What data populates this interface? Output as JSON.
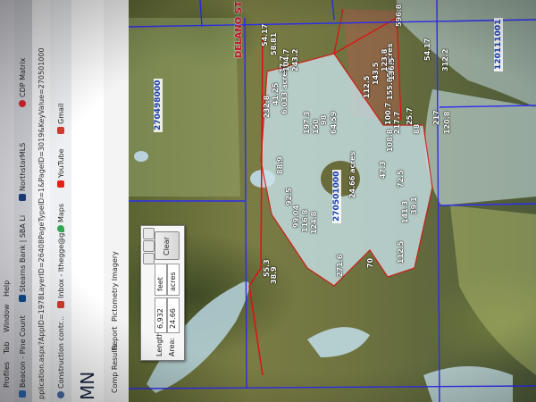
{
  "browser": {
    "menu": [
      "Profiles",
      "Tab",
      "Window",
      "Help"
    ],
    "tabs": [
      "Beacon - Pine Count",
      "Stearns Bank | SBA Li",
      "NorthstarMLS",
      "CDP Matrix"
    ],
    "url_fragment": "pplication.aspx?AppID=1978LayerID=26408PageTypeID=1&PageID=3019&KeyValue=270501000",
    "bookmarks": [
      "Construction contr...",
      "Inbox - lthegge@g...",
      "Maps",
      "YouTube",
      "Gmail"
    ]
  },
  "page": {
    "heading_partial": "MN"
  },
  "app_toolbar": {
    "items": [
      "Comp Results",
      "Report",
      "Pictometry Imagery"
    ]
  },
  "measure_tool": {
    "length_label": "Length:",
    "length_value": "6,932",
    "length_unit": "feet",
    "area_label": "Area:",
    "area_value": "24.66",
    "area_unit": "acres",
    "clear_label": "Clear"
  },
  "map": {
    "parcel_ids": [
      "270498000",
      "270501000",
      "120111001"
    ],
    "road_label": "DELANO ST",
    "area_annotations": [
      "24.66 acres",
      "6.033 acres",
      "155.858 acres"
    ],
    "segment_labels": [
      "54.17",
      "58.81",
      "232.8",
      "41.25",
      "37.7",
      "104.7",
      "243.2",
      "197.3",
      "150",
      "98",
      "64.59",
      "88.9",
      "92.5",
      "99.04",
      "116.8",
      "124.8",
      "55.3",
      "38.9",
      "271.6",
      "70",
      "112.5",
      "141.3",
      "39.1",
      "47.3",
      "72.5",
      "108.8",
      "217.7",
      "25.7",
      "88",
      "112.5",
      "143.5",
      "123.8",
      "136.5",
      "596.8",
      "312.2",
      "217",
      "120.8",
      "54.17",
      "100.7"
    ]
  },
  "colors": {
    "parcel_line": "#2d2df0",
    "measure_line": "#e01010",
    "measure_fill": "#c9e4ec",
    "page_edge": "#7a0f2a"
  },
  "icons": {
    "bookmark_inbox": "gmail-icon",
    "bookmark_maps": "maps-pin-icon",
    "bookmark_youtube": "youtube-icon",
    "tab_cdp": "cdp-icon"
  }
}
